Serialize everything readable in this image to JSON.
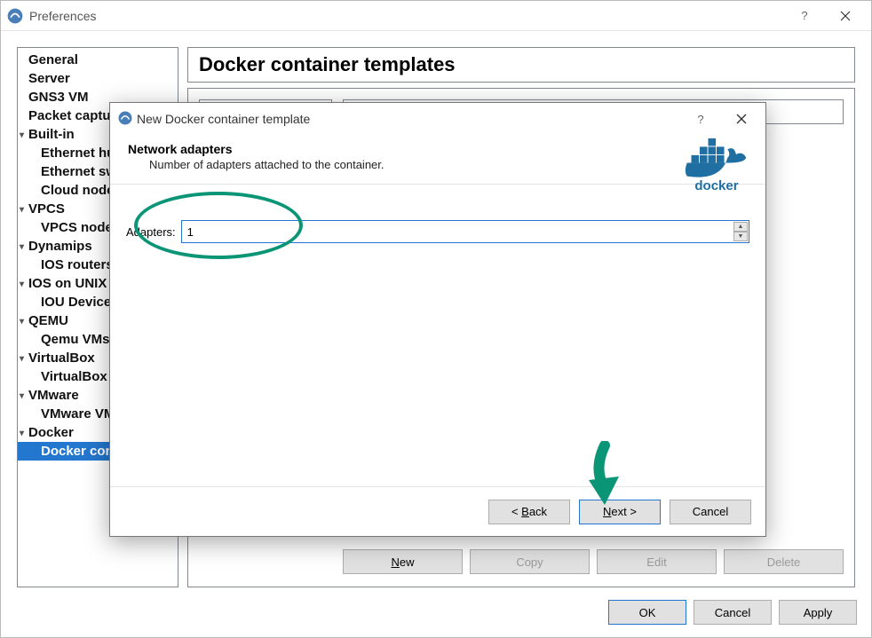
{
  "prefs": {
    "title": "Preferences",
    "page_title": "Docker container templates",
    "sidebar": [
      {
        "label": "General",
        "child": false,
        "caret": false
      },
      {
        "label": "Server",
        "child": false,
        "caret": false
      },
      {
        "label": "GNS3 VM",
        "child": false,
        "caret": false
      },
      {
        "label": "Packet capture",
        "child": false,
        "caret": false
      },
      {
        "label": "Built-in",
        "child": false,
        "caret": true
      },
      {
        "label": "Ethernet hubs",
        "child": true,
        "caret": false
      },
      {
        "label": "Ethernet switches",
        "child": true,
        "caret": false
      },
      {
        "label": "Cloud nodes",
        "child": true,
        "caret": false
      },
      {
        "label": "VPCS",
        "child": false,
        "caret": true
      },
      {
        "label": "VPCS nodes",
        "child": true,
        "caret": false
      },
      {
        "label": "Dynamips",
        "child": false,
        "caret": true
      },
      {
        "label": "IOS routers",
        "child": true,
        "caret": false
      },
      {
        "label": "IOS on UNIX",
        "child": false,
        "caret": true
      },
      {
        "label": "IOU Devices",
        "child": true,
        "caret": false
      },
      {
        "label": "QEMU",
        "child": false,
        "caret": true
      },
      {
        "label": "Qemu VMs",
        "child": true,
        "caret": false
      },
      {
        "label": "VirtualBox",
        "child": false,
        "caret": true
      },
      {
        "label": "VirtualBox VMs",
        "child": true,
        "caret": false
      },
      {
        "label": "VMware",
        "child": false,
        "caret": true
      },
      {
        "label": "VMware VMs",
        "child": true,
        "caret": false
      },
      {
        "label": "Docker",
        "child": false,
        "caret": true
      },
      {
        "label": "Docker containers",
        "child": true,
        "caret": false,
        "selected": true
      }
    ],
    "template_buttons": {
      "new": "New",
      "copy": "Copy",
      "edit": "Edit",
      "delete": "Delete"
    },
    "buttons": {
      "ok": "OK",
      "cancel": "Cancel",
      "apply": "Apply"
    }
  },
  "modal": {
    "title": "New Docker container template",
    "heading": "Network adapters",
    "subheading": "Number of adapters attached to the container.",
    "adapter_label": "Adapters:",
    "adapter_value": "1",
    "logo_text": "docker",
    "buttons": {
      "back": "< Back",
      "next": "Next >",
      "cancel": "Cancel"
    }
  }
}
